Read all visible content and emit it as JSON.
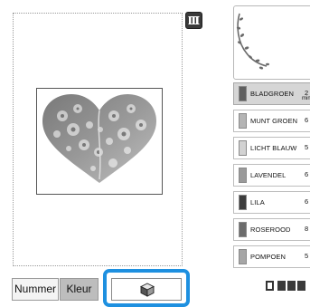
{
  "buttons": {
    "number_label": "Nummer",
    "color_label": "Kleur"
  },
  "thread_colors": [
    {
      "name": "BLADGROEN",
      "count": "2",
      "unit": "min",
      "swatch": "#5f5f5f",
      "selected": true
    },
    {
      "name": "MUNT GROEN",
      "count": "6",
      "unit": "",
      "swatch": "#b4b4b4",
      "selected": false
    },
    {
      "name": "LICHT BLAUW",
      "count": "5",
      "unit": "",
      "swatch": "#d2d2d2",
      "selected": false
    },
    {
      "name": "LAVENDEL",
      "count": "6",
      "unit": "",
      "swatch": "#9a9a9a",
      "selected": false
    },
    {
      "name": "LILA",
      "count": "6",
      "unit": "",
      "swatch": "#3c3c3c",
      "selected": false
    },
    {
      "name": "ROSEROOD",
      "count": "8",
      "unit": "",
      "swatch": "#6c6c6c",
      "selected": false
    },
    {
      "name": "POMPOEN",
      "count": "5",
      "unit": "",
      "swatch": "#a6a6a6",
      "selected": false
    }
  ],
  "icons": {
    "thread_view": "thread-spools-icon",
    "view_3d": "3d-cube-icon"
  },
  "colors": {
    "highlight": "#1e90e0"
  }
}
